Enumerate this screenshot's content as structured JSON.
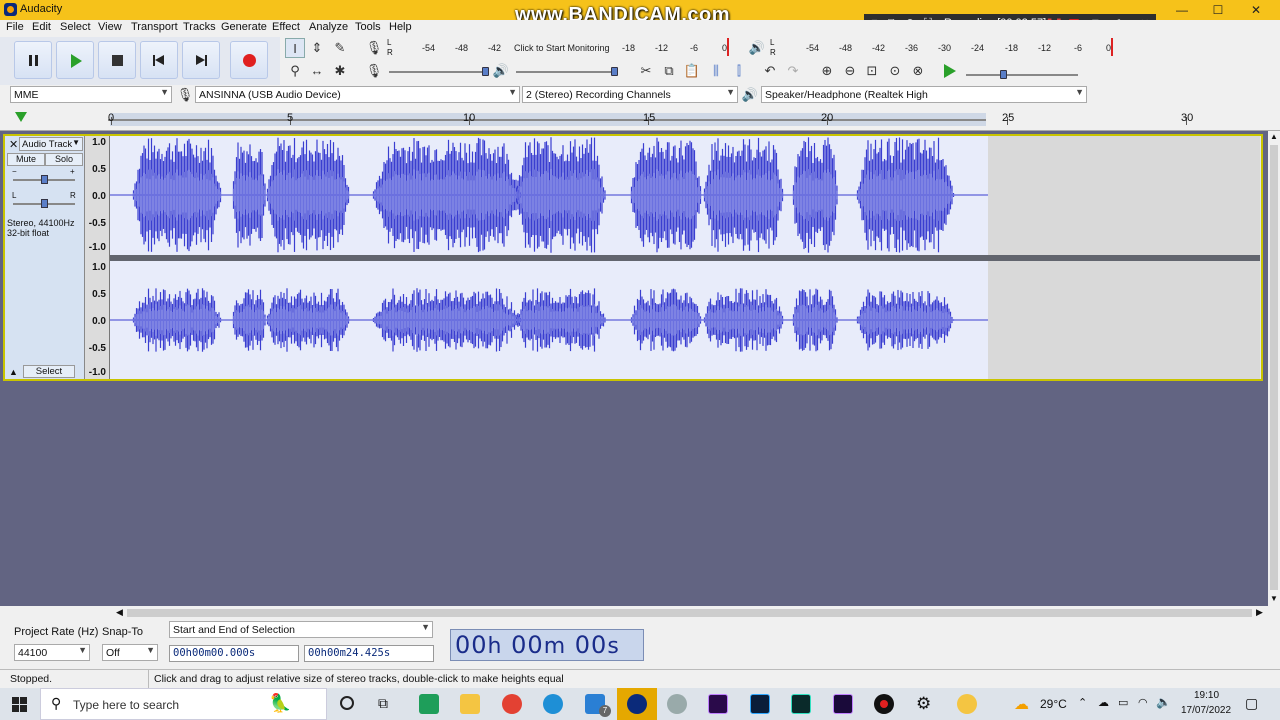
{
  "window": {
    "title": "Audacity",
    "watermark": "www.BANDICAM.com",
    "minimize": "—",
    "maximize": "☐",
    "close": "✕"
  },
  "recorder": {
    "label": "Recording [00:02:57]"
  },
  "menu": [
    "File",
    "Edit",
    "Select",
    "View",
    "Transport",
    "Tracks",
    "Generate",
    "Effect",
    "Analyze",
    "Tools",
    "Help"
  ],
  "meters": {
    "record_scale": [
      "-54",
      "-48",
      "-42",
      "Click to Start Monitoring",
      "-18",
      "-12",
      "-6",
      "0"
    ],
    "playback_scale": [
      "-54",
      "-48",
      "-42",
      "-36",
      "-30",
      "-24",
      "-18",
      "-12",
      "-6",
      "0"
    ],
    "lr_top": "L",
    "lr_bottom": "R"
  },
  "devices": {
    "host": "MME",
    "recording_device": "ANSINNA (USB Audio Device)",
    "channels": "2 (Stereo) Recording Channels",
    "playback_device": "Speaker/Headphone (Realtek High"
  },
  "ruler": {
    "labels": [
      "0",
      "5",
      "10",
      "15",
      "20",
      "25",
      "30"
    ]
  },
  "track": {
    "name": "Audio Track",
    "mute": "Mute",
    "solo": "Solo",
    "gain_minus": "−",
    "gain_plus": "+",
    "pan_left": "L",
    "pan_right": "R",
    "info_line1": "Stereo, 44100Hz",
    "info_line2": "32-bit float",
    "select": "Select",
    "scale": [
      "1.0",
      "0.5",
      "0.0",
      "-0.5",
      "-1.0"
    ]
  },
  "selection_toolbar": {
    "project_rate_label": "Project Rate (Hz)",
    "project_rate": "44100",
    "snap_label": "Snap-To",
    "snap_value": "Off",
    "selection_mode": "Start and End of Selection",
    "start_time": "00h00m00.000s",
    "end_time": "00h00m24.425s",
    "audio_position": {
      "h": "00",
      "m": "00",
      "s": "00",
      "hu": "h",
      "mu": "m",
      "su": "s"
    }
  },
  "status": {
    "state": "Stopped.",
    "hint": "Click and drag to adjust relative size of stereo tracks, double-click to make heights equal"
  },
  "taskbar": {
    "search_placeholder": "Type here to search",
    "temperature": "29°C",
    "time": "19:10",
    "date": "17/07/2022",
    "mail_badge": "7"
  },
  "colors": {
    "waveform": "#3a3ed0",
    "waveform_rms": "#6b71e0",
    "track_bg": "#e8ecfa",
    "titlebar": "#f6c21a",
    "empty_area": "#626482"
  }
}
